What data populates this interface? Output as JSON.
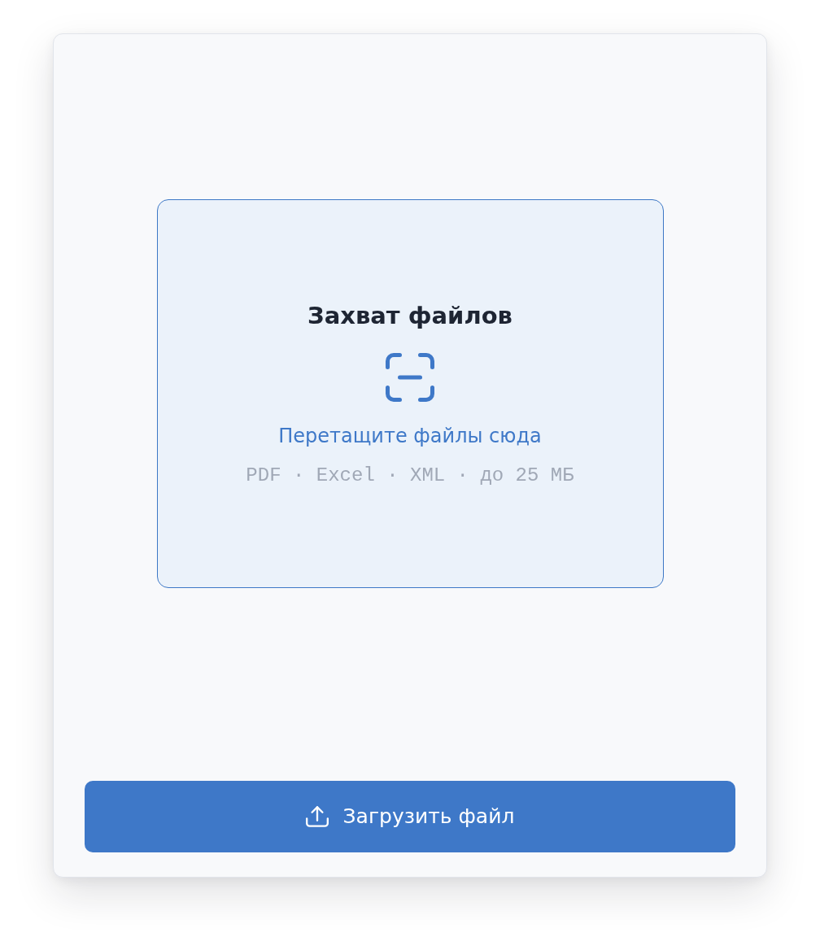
{
  "dropzone": {
    "title": "Захват файлов",
    "hint": "Перетащите файлы сюда",
    "formats": "PDF · Excel · XML · до 25 МБ"
  },
  "upload_button": {
    "label": "Загрузить файл"
  }
}
